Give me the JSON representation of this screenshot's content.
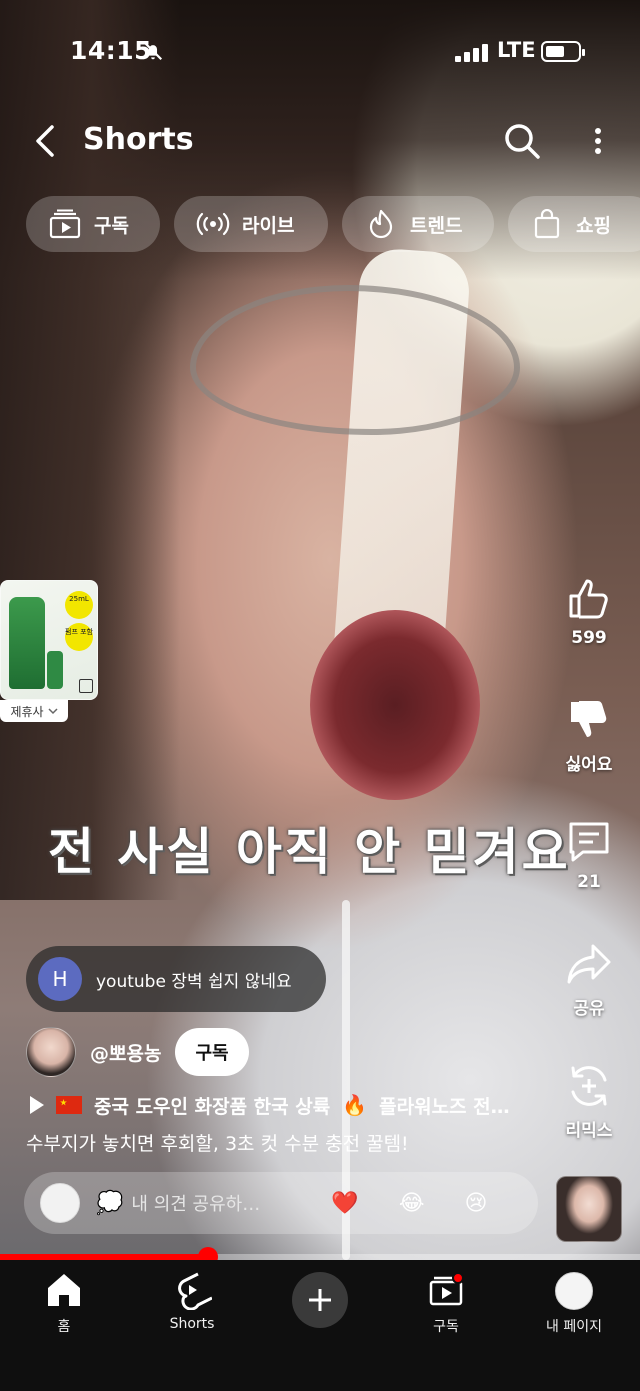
{
  "status_bar": {
    "time": "14:15",
    "network": "LTE",
    "silent": true,
    "battery_level": 0.45
  },
  "header": {
    "title": "Shorts",
    "back_icon": "chevron-left-icon",
    "search_icon": "search-icon",
    "more_icon": "more-vertical-icon"
  },
  "chips": [
    {
      "label": "구독",
      "icon": "subscriptions-icon"
    },
    {
      "label": "라이브",
      "icon": "live-icon"
    },
    {
      "label": "트렌드",
      "icon": "trending-icon"
    },
    {
      "label": "쇼핑",
      "icon": "shopping-bag-icon"
    }
  ],
  "product_card": {
    "badge_size": "25mL",
    "badge_gift": "펌프 포함",
    "partner_label": "제휴사"
  },
  "actions": {
    "like_count": "599",
    "dislike_label": "싫어요",
    "comment_count": "21",
    "share_label": "공유",
    "remix_label": "리믹스"
  },
  "overlay_caption": "전 사실 아직 안 믿겨요",
  "pinned_comment": {
    "avatar_letter": "H",
    "text": "youtube 장벽 쉽지 않네요"
  },
  "channel": {
    "handle": "@뽀용농",
    "subscribe_label": "구독"
  },
  "video": {
    "title": "중국 도우인 화장품 한국 상륙",
    "title_rest": "플라워노즈 전…",
    "description": "수부지가 놓치면 후회할, 3초 컷 수분 충전 꿀템!"
  },
  "comment_input": {
    "placeholder": "내 의견 공유하…",
    "emoji_1": "❤️",
    "emoji_2": "😂",
    "emoji_3": "😢"
  },
  "progress": {
    "fraction": 0.325
  },
  "bottom_nav": [
    {
      "label": "홈",
      "icon": "home-icon"
    },
    {
      "label": "Shorts",
      "icon": "shorts-icon"
    },
    {
      "label": "",
      "icon": "plus-icon"
    },
    {
      "label": "구독",
      "icon": "subscriptions-icon"
    },
    {
      "label": "내 페이지",
      "icon": "avatar"
    }
  ],
  "colors": {
    "accent": "#ff0000",
    "nav_bg": "#0f0f0f",
    "chip_bg": "rgba(255,255,255,0.22)"
  }
}
